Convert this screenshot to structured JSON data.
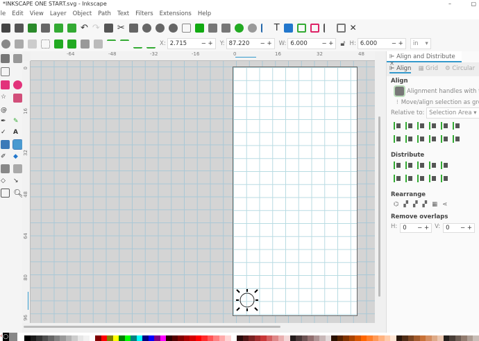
{
  "window": {
    "title": "*INKSCAPE ONE START.svg - Inkscape"
  },
  "menu": [
    "File",
    "Edit",
    "View",
    "Layer",
    "Object",
    "Path",
    "Text",
    "Filters",
    "Extensions",
    "Help"
  ],
  "toolbar": {
    "x_label": "X:",
    "x": "2.715",
    "y_label": "Y:",
    "y": "87.220",
    "w_label": "W:",
    "w": "6.000",
    "h_label": "H:",
    "h": "6.000",
    "unit": "in"
  },
  "ruler_h": [
    "-64",
    "-48",
    "-32",
    "-16",
    "0",
    "16",
    "32",
    "48"
  ],
  "ruler_v": [
    "0",
    "16",
    "32",
    "48",
    "64",
    "80",
    "96"
  ],
  "panel": {
    "tab": "Align and Distribute",
    "subtabs": [
      "Align",
      "Grid",
      "Circular"
    ],
    "align_title": "Align",
    "handles": "Alignment handles with this tool",
    "move_group": "Move/align selection as group",
    "relative_label": "Relative to:",
    "relative_value": "Selection Area",
    "distribute_title": "Distribute",
    "rearrange_title": "Rearrange",
    "overlaps_title": "Remove overlaps",
    "h_label": "H:",
    "h_value": "0",
    "v_label": "V:",
    "v_value": "0"
  },
  "palette": [
    "#000000",
    "#1a1a1a",
    "#333333",
    "#4d4d4d",
    "#666666",
    "#808080",
    "#999999",
    "#b3b3b3",
    "#cccccc",
    "#e6e6e6",
    "#f2f2f2",
    "#ffffff",
    "#800000",
    "#ff0000",
    "#808000",
    "#ffff00",
    "#008000",
    "#00ff00",
    "#008080",
    "#00ffff",
    "#000080",
    "#0000ff",
    "#800080",
    "#ff00ff",
    "#2b0000",
    "#550000",
    "#800000",
    "#aa0000",
    "#d40000",
    "#ff0000",
    "#ff2a2a",
    "#ff5555",
    "#ff8080",
    "#ffaaaa",
    "#ffd5d5",
    "#ffffff",
    "#280b0b",
    "#501616",
    "#782121",
    "#a02c2c",
    "#c83737",
    "#d35f5f",
    "#de8787",
    "#e9afaf",
    "#f4d7d7",
    "#241c1c",
    "#483737",
    "#6c5353",
    "#916f6f",
    "#ac9393",
    "#c8b7b7",
    "#e3dbdb",
    "#2b1100",
    "#552200",
    "#803300",
    "#aa4400",
    "#d45500",
    "#ff6600",
    "#ff7f2a",
    "#ff9955",
    "#ffb380",
    "#ffccaa",
    "#ffe6d5",
    "#28170b",
    "#502d16",
    "#784421",
    "#a05a2c",
    "#c87137",
    "#d38d5f",
    "#deaa87",
    "#e9c6af",
    "#241f1c",
    "#483e37",
    "#6c5d53",
    "#917c6f",
    "#ac9d93",
    "#c8beb7"
  ]
}
